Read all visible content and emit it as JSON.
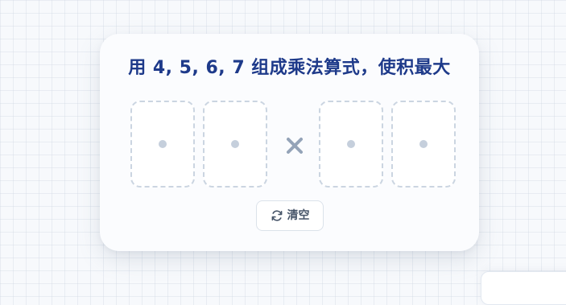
{
  "puzzle": {
    "title": "用 4, 5, 6, 7 组成乘法算式，使积最大",
    "slots": [
      {
        "value": ""
      },
      {
        "value": ""
      },
      {
        "value": ""
      },
      {
        "value": ""
      }
    ],
    "operator_icon": "times-icon",
    "clear_button": {
      "label": "清空",
      "icon": "refresh-icon"
    }
  },
  "colors": {
    "title": "#1e3a8a",
    "slot_border": "#cbd5e1",
    "slot_dot": "#c5cfdc",
    "operator": "#94a3b8",
    "button_text": "#475569"
  }
}
